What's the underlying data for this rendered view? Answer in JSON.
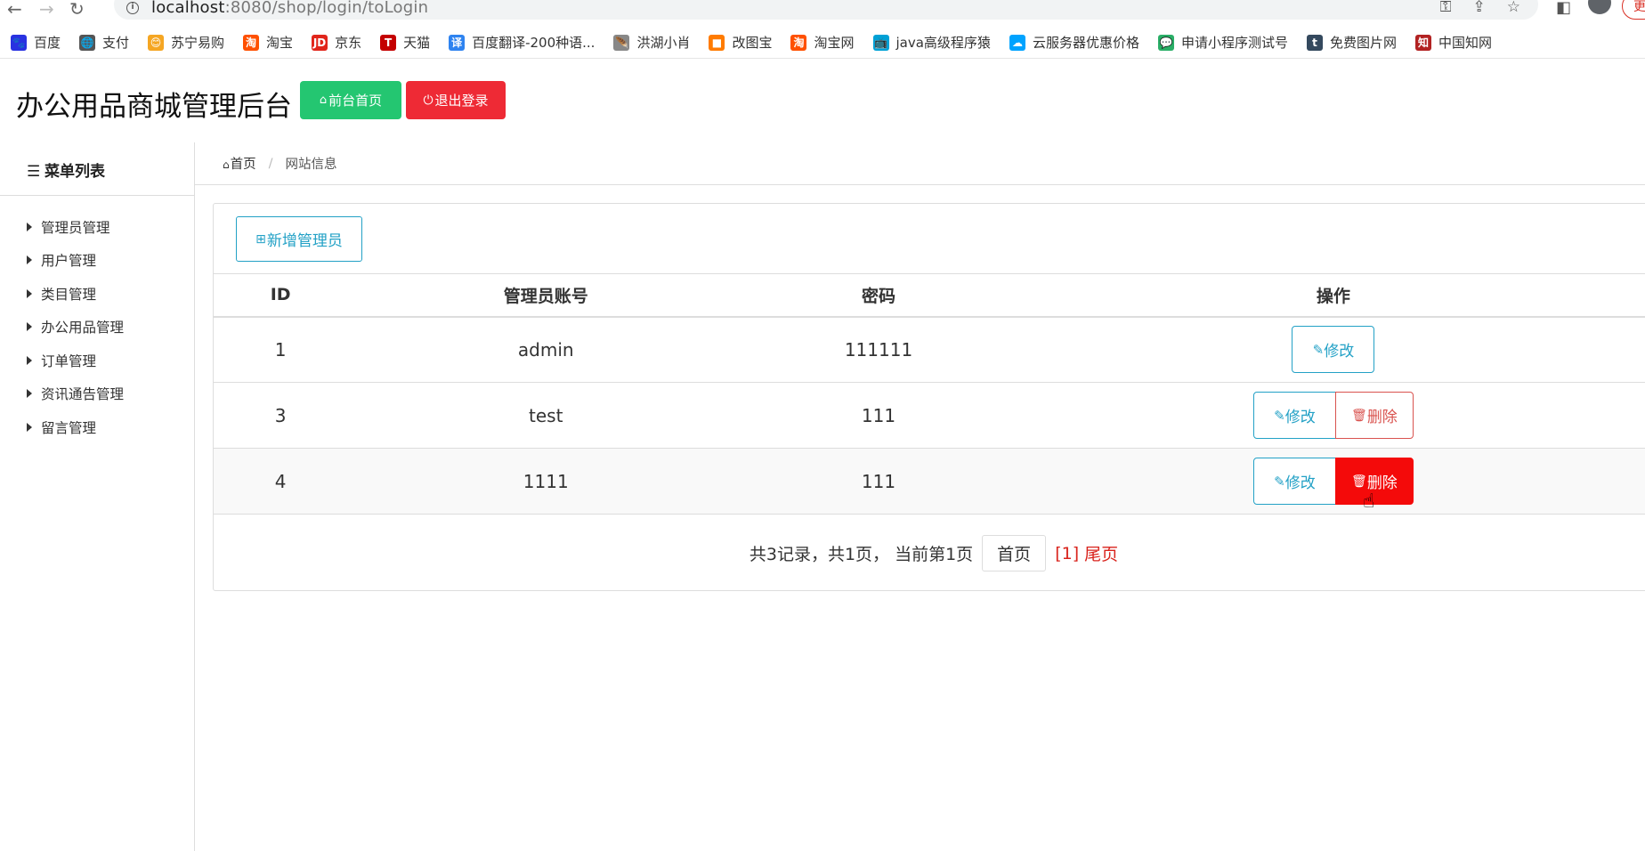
{
  "browser": {
    "url_host": "localhost",
    "url_path": ":8080/shop/login/toLogin",
    "update_label": "更"
  },
  "bookmarks": [
    {
      "label": "百度",
      "color": "#2932e1",
      "glyph": "🐾"
    },
    {
      "label": "支付",
      "color": "#555",
      "glyph": "🌐"
    },
    {
      "label": "苏宁易购",
      "color": "#f5a623",
      "glyph": "😊"
    },
    {
      "label": "淘宝",
      "color": "#ff5000",
      "glyph": "淘"
    },
    {
      "label": "京东",
      "color": "#e1251b",
      "glyph": "JD"
    },
    {
      "label": "天猫",
      "color": "#c40000",
      "glyph": "T"
    },
    {
      "label": "百度翻译-200种语...",
      "color": "#2e83f0",
      "glyph": "译"
    },
    {
      "label": "洪湖小肖",
      "color": "#888",
      "glyph": "🪶"
    },
    {
      "label": "改图宝",
      "color": "#ff7b00",
      "glyph": "■"
    },
    {
      "label": "淘宝网",
      "color": "#ff5000",
      "glyph": "淘"
    },
    {
      "label": "java高级程序猿",
      "color": "#00a1d6",
      "glyph": "📺"
    },
    {
      "label": "云服务器优惠价格",
      "color": "#00a3ff",
      "glyph": "☁"
    },
    {
      "label": "申请小程序测试号",
      "color": "#2aae67",
      "glyph": "💬"
    },
    {
      "label": "免费图片网",
      "color": "#34495e",
      "glyph": "t"
    },
    {
      "label": "中国知网",
      "color": "#b22222",
      "glyph": "知"
    }
  ],
  "header": {
    "title": "办公用品商城管理后台",
    "home_label": "前台首页",
    "logout_label": "退出登录"
  },
  "sidebar": {
    "title": "菜单列表",
    "items": [
      "管理员管理",
      "用户管理",
      "类目管理",
      "办公用品管理",
      "订单管理",
      "资讯通告管理",
      "留言管理"
    ]
  },
  "breadcrumb": {
    "home": "首页",
    "current": "网站信息"
  },
  "main": {
    "add_label": "新增管理员",
    "columns": [
      "ID",
      "管理员账号",
      "密码",
      "操作"
    ],
    "rows": [
      {
        "id": "1",
        "account": "admin",
        "password": "111111"
      },
      {
        "id": "3",
        "account": "test",
        "password": "111"
      },
      {
        "id": "4",
        "account": "1111",
        "password": "111"
      }
    ],
    "edit_label": "修改",
    "delete_label": "删除"
  },
  "pager": {
    "summary": "共3记录，共1页， 当前第1页",
    "first_label": "首页",
    "current_page": "[1]",
    "last_label": "尾页"
  },
  "colors": {
    "accent": "#23a1c6",
    "success": "#24c671",
    "danger": "#ee2a35",
    "danger_hover": "#f40a0a"
  }
}
